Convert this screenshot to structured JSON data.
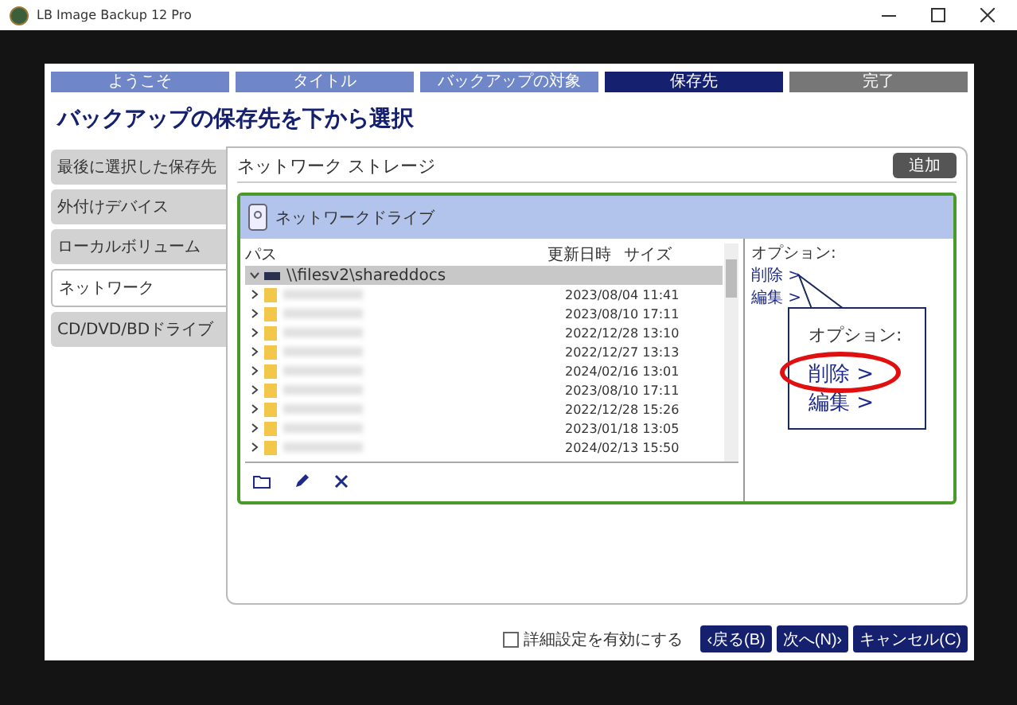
{
  "window": {
    "title": "LB Image Backup 12 Pro"
  },
  "steps": [
    {
      "label": "ようこそ",
      "selected": false,
      "completed": true
    },
    {
      "label": "タイトル",
      "selected": false,
      "completed": true
    },
    {
      "label": "バックアップの対象",
      "selected": false,
      "completed": true
    },
    {
      "label": "保存先",
      "selected": true
    },
    {
      "label": "完了",
      "selected": false,
      "completed": false
    }
  ],
  "heading": "バックアップの保存先を下から選択",
  "sidebar": {
    "items": [
      {
        "label": "最後に選択した保存先",
        "selected": false
      },
      {
        "label": "外付けデバイス",
        "selected": false
      },
      {
        "label": "ローカルボリューム",
        "selected": false
      },
      {
        "label": "ネットワーク",
        "selected": true
      },
      {
        "label": "CD/DVD/BDドライブ",
        "selected": false
      }
    ]
  },
  "storage": {
    "title": "ネットワーク ストレージ",
    "add_button": "追加",
    "drive": {
      "name": "ネットワークドライブ"
    },
    "columns": [
      "パス",
      "更新日時",
      "サイズ"
    ],
    "tree": [
      {
        "name": "\\\\filesv2\\shareddocs",
        "expanded": true,
        "children": [
          {
            "modified": "2023/08/04 11:41"
          },
          {
            "modified": "2023/08/10 17:11"
          },
          {
            "modified": "2022/12/28 13:10"
          },
          {
            "modified": "2022/12/27 13:13"
          },
          {
            "modified": "2024/02/16 13:01"
          },
          {
            "modified": "2023/08/10 17:11"
          },
          {
            "modified": "2022/12/28 15:26"
          },
          {
            "modified": "2023/01/18 13:05"
          },
          {
            "modified": "2024/02/13 15:50"
          }
        ]
      }
    ],
    "options": {
      "label": "オプション:",
      "links": [
        "削除 >",
        "編集 >"
      ]
    }
  },
  "callout": {
    "label": "オプション:",
    "links": [
      {
        "text": "削除 >",
        "circled": true
      },
      {
        "text": "編集 >",
        "circled": false
      }
    ]
  },
  "footer": {
    "checkbox": {
      "label": "詳細設定を有効にする",
      "checked": false
    },
    "buttons": [
      "‹戻る(B)",
      "次へ(N)›",
      "キャンセル(C)"
    ]
  }
}
